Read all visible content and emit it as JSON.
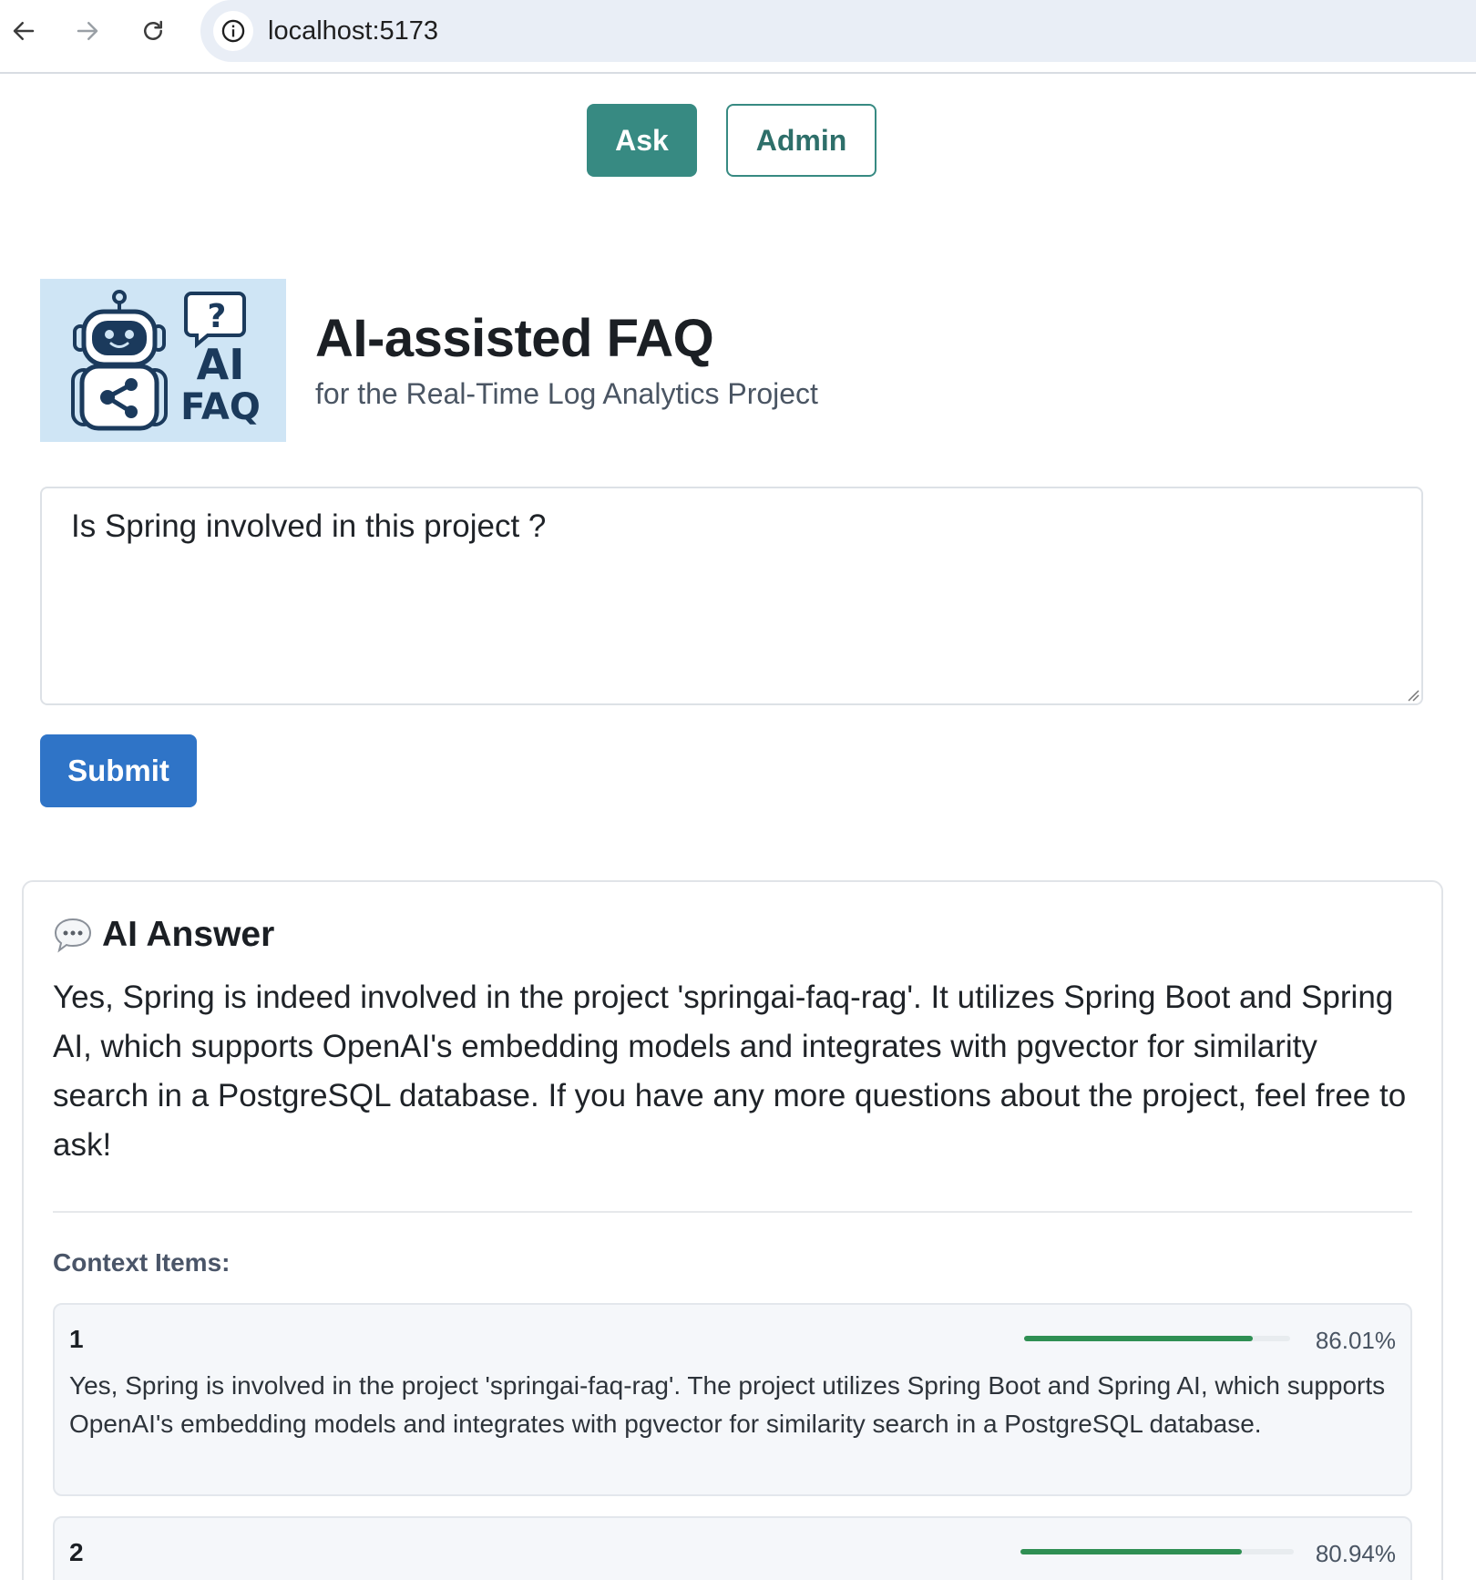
{
  "browser": {
    "url": "localhost:5173"
  },
  "nav": {
    "ask_label": "Ask",
    "admin_label": "Admin"
  },
  "header": {
    "logo_text_line1": "AI",
    "logo_text_line2": "FAQ",
    "logo_question_mark": "?",
    "title": "AI-assisted FAQ",
    "subtitle": "for the Real-Time Log Analytics Project"
  },
  "question": {
    "value": "Is Spring involved in this project ?"
  },
  "submit_label": "Submit",
  "answer": {
    "heading": "AI Answer",
    "text": "Yes, Spring is indeed involved in the project 'springai-faq-rag'. It utilizes Spring Boot and Spring AI, which supports OpenAI's embedding models and integrates with pgvector for similarity search in a PostgreSQL database. If you have any more questions about the project, feel free to ask!",
    "context_label": "Context Items:",
    "context_items": [
      {
        "index": "1",
        "score": "86.01%",
        "score_fraction": 0.8601,
        "text": "Yes, Spring is involved in the project 'springai-faq-rag'. The project utilizes Spring Boot and Spring AI, which supports OpenAI's embedding models and integrates with pgvector for similarity search in a PostgreSQL database."
      },
      {
        "index": "2",
        "score": "80.94%",
        "score_fraction": 0.8094,
        "text": ""
      }
    ]
  },
  "colors": {
    "ask_tab": "#378a82",
    "submit": "#2f74c7",
    "score_bar": "#2f8f53",
    "logo_bg": "#cfe5f5"
  }
}
